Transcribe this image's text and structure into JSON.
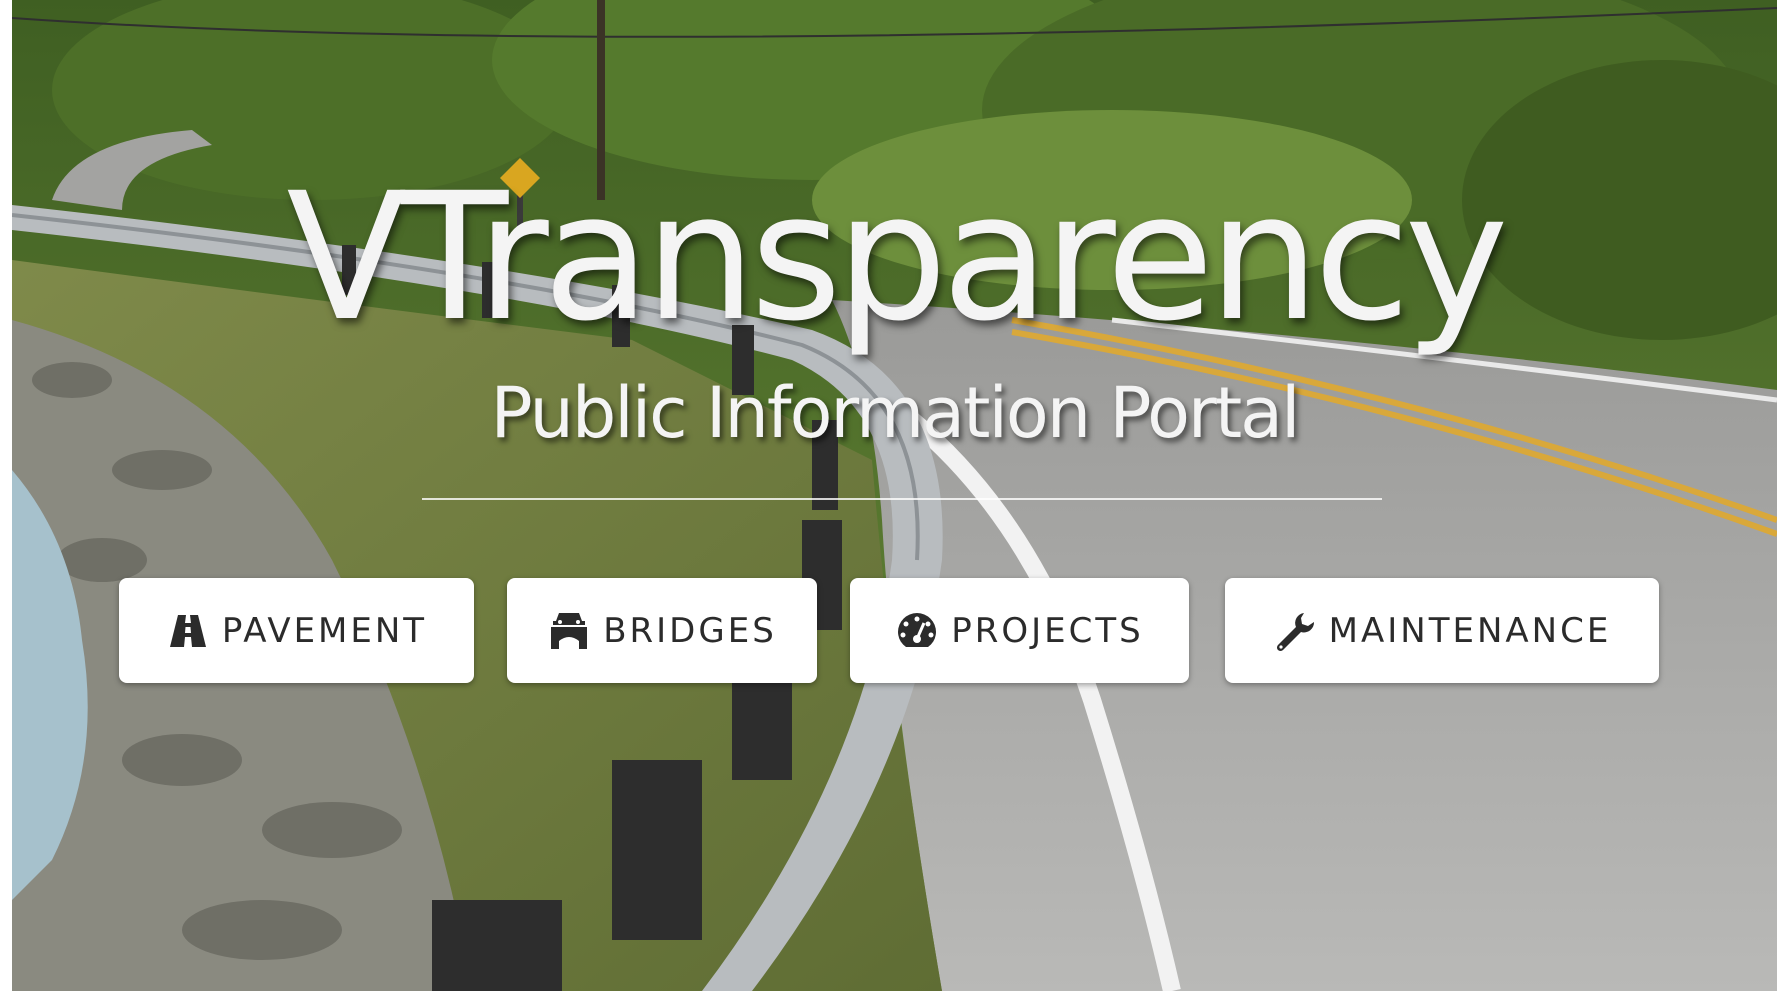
{
  "hero": {
    "title": "VTransparency",
    "subtitle": "Public Information Portal"
  },
  "nav": {
    "pavement": {
      "label": "PAVEMENT",
      "icon": "road-icon"
    },
    "bridges": {
      "label": "BRIDGES",
      "icon": "car-bridge-icon"
    },
    "projects": {
      "label": "PROJECTS",
      "icon": "dashboard-gauge-icon"
    },
    "maintenance": {
      "label": "MAINTENANCE",
      "icon": "wrench-icon"
    }
  },
  "colors": {
    "title_text": "#f4f4f4",
    "button_bg": "#ffffff",
    "button_text": "#2b2b2b"
  }
}
